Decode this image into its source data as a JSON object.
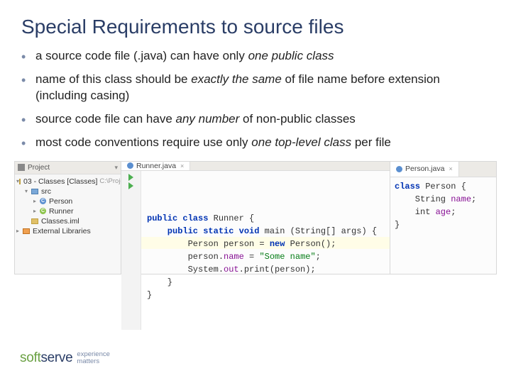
{
  "title": "Special Requirements to source files",
  "bullets": [
    {
      "pre": "a source code file (.java) can have only ",
      "em": "one public class",
      "post": ""
    },
    {
      "pre": "name of this class should be ",
      "em": "exactly the same",
      "post": " of file name before extension (including casing)"
    },
    {
      "pre": "source code file can have ",
      "em": "any number",
      "post": " of non-public classes"
    },
    {
      "pre": "most code conventions require use only ",
      "em": "one top-level class",
      "post": " per file"
    }
  ],
  "ide": {
    "projectLabel": "Project",
    "rootFolder": "03 - Classes [Classes]",
    "rootPath": "C:\\Projects\\ITA\\Java Rem",
    "srcFolder": "src",
    "classPerson": "Person",
    "classRunner": "Runner",
    "classesIml": "Classes.iml",
    "externalLibs": "External Libraries",
    "tabRunner": "Runner.java",
    "tabPerson": "Person.java",
    "runnerCode": {
      "l1a": "public class",
      "l1b": " Runner {",
      "l2a": "    public static void",
      "l2b": " main (String[] args) {",
      "l3a": "        Person person = ",
      "l3b": "new",
      "l3c": " Person();",
      "l4a": "        person.",
      "l4b": "name",
      "l4c": " = ",
      "l4d": "\"Some name\"",
      "l4e": ";",
      "l5a": "        System.",
      "l5b": "out",
      "l5c": ".print(person);",
      "l6": "    }",
      "l7": "}"
    },
    "personCode": {
      "l1a": "class",
      "l1b": " Person {",
      "l2a": "    String ",
      "l2b": "name",
      "l2c": ";",
      "l3a": "    int ",
      "l3b": "age",
      "l3c": ";",
      "l4": "}"
    }
  },
  "logo": {
    "part1": "soft",
    "part2": "serve",
    "tag1": "experience",
    "tag2": "matters"
  }
}
